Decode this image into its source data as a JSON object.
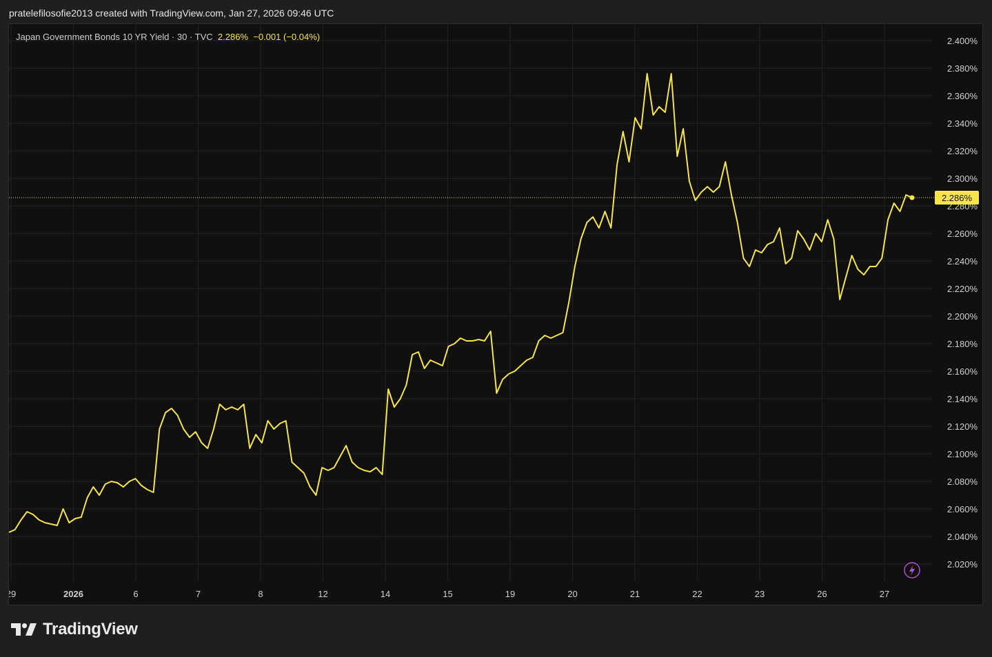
{
  "header": {
    "title": "pratelefilosofie2013 created with TradingView.com, Jan 27, 2026 09:46 UTC"
  },
  "legend": {
    "symbol": "Japan Government Bonds 10 YR Yield · 30 · TVC",
    "last_value": "2.286%",
    "change": "−0.001 (−0.04%)"
  },
  "brand": {
    "name": "TradingView",
    "logo_icon": "tradingview-logo-icon"
  },
  "colors": {
    "line": "#f7e54b",
    "panel_background": "#101010",
    "grid": "#232323",
    "axis_text": "#d0d0d0",
    "price_label_background": "#f7e54b",
    "bolt_icon": "#b14fd3"
  },
  "chart_data": {
    "type": "line",
    "title": "",
    "xlabel": "",
    "ylabel": "",
    "ylim": [
      2.008,
      2.412
    ],
    "y_ticks": [
      "2.020%",
      "2.040%",
      "2.060%",
      "2.080%",
      "2.100%",
      "2.120%",
      "2.140%",
      "2.160%",
      "2.180%",
      "2.200%",
      "2.220%",
      "2.240%",
      "2.260%",
      "2.280%",
      "2.300%",
      "2.320%",
      "2.340%",
      "2.360%",
      "2.380%",
      "2.400%"
    ],
    "x_ticks": [
      "29",
      "2026",
      "6",
      "7",
      "8",
      "12",
      "14",
      "15",
      "19",
      "20",
      "21",
      "22",
      "23",
      "26",
      "27"
    ],
    "last_value": 2.286,
    "last_value_label": "2.286%",
    "grid": true,
    "series": [
      {
        "values": [
          2.043,
          2.045,
          2.052,
          2.058,
          2.056,
          2.052,
          2.05,
          2.049,
          2.048,
          2.06,
          2.05,
          2.053,
          2.054,
          2.068,
          2.076,
          2.07,
          2.078,
          2.08,
          2.079,
          2.076,
          2.08,
          2.082,
          2.077,
          2.074,
          2.072,
          2.118,
          2.13,
          2.133,
          2.128,
          2.118,
          2.112,
          2.116,
          2.108,
          2.104,
          2.118,
          2.136,
          2.132,
          2.134,
          2.132,
          2.136,
          2.104,
          2.114,
          2.108,
          2.124,
          2.118,
          2.122,
          2.124,
          2.094,
          2.09,
          2.086,
          2.076,
          2.07,
          2.09,
          2.088,
          2.09,
          2.098,
          2.106,
          2.094,
          2.09,
          2.088,
          2.087,
          2.09,
          2.085,
          2.147,
          2.134,
          2.14,
          2.15,
          2.172,
          2.174,
          2.162,
          2.168,
          2.166,
          2.164,
          2.178,
          2.18,
          2.184,
          2.182,
          2.182,
          2.183,
          2.182,
          2.189,
          2.144,
          2.154,
          2.158,
          2.16,
          2.164,
          2.168,
          2.17,
          2.182,
          2.186,
          2.184,
          2.186,
          2.188,
          2.21,
          2.236,
          2.256,
          2.268,
          2.272,
          2.264,
          2.276,
          2.264,
          2.31,
          2.334,
          2.312,
          2.344,
          2.336,
          2.376,
          2.346,
          2.352,
          2.348,
          2.376,
          2.316,
          2.336,
          2.298,
          2.284,
          2.29,
          2.294,
          2.29,
          2.294,
          2.312,
          2.288,
          2.268,
          2.242,
          2.236,
          2.248,
          2.246,
          2.252,
          2.254,
          2.264,
          2.238,
          2.242,
          2.262,
          2.256,
          2.248,
          2.26,
          2.254,
          2.27,
          2.256,
          2.212,
          2.228,
          2.244,
          2.234,
          2.23,
          2.236,
          2.236,
          2.242,
          2.27,
          2.282,
          2.276,
          2.288,
          2.286
        ]
      }
    ]
  }
}
